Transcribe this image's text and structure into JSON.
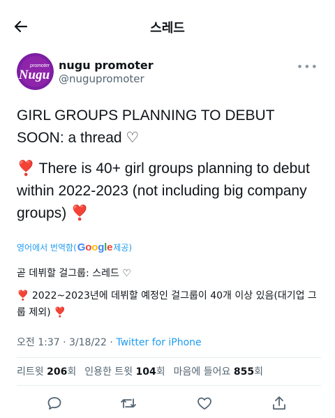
{
  "topbar": {
    "title": "스레드"
  },
  "author": {
    "name": "nugu promoter",
    "handle": "@nugupromoter",
    "avatar_text_top": "promoter",
    "avatar_text": "Nugu"
  },
  "tweet": {
    "title_line": "GIRL GROUPS PLANNING TO DEBUT SOON: a thread ♡",
    "emoji_heart": "❣️",
    "body": "There is 40+ girl groups planning to debut within 2022-2023 (not including big company groups)"
  },
  "translate": {
    "prefix": "영어에서 번역함(",
    "brand": "Google",
    "suffix": " 제공)"
  },
  "translation": {
    "line1": "곧 데뷔할 걸그룹: 스레드 ♡",
    "line2": "2022~2023년에 데뷔할 예정인 걸그룹이 40개 이상 있음(대기업 그룹 제외)"
  },
  "meta": {
    "time": "오전 1:37 · 3/18/22 · ",
    "source": "Twitter for iPhone"
  },
  "stats": {
    "retweets_label": "리트윗",
    "retweets": "206",
    "retweets_unit": "회",
    "quotes_label": "인용한 트윗",
    "quotes": "104",
    "quotes_unit": "회",
    "likes_label": "마음에 들어요",
    "likes": "855",
    "likes_unit": "회"
  },
  "actions": [
    "reply-icon",
    "retweet-icon",
    "like-icon",
    "share-icon"
  ],
  "colors": {
    "accent": "#1d9bf0",
    "muted": "#536471",
    "avatar_bg": "#7b1fa2",
    "heart": "#d0021b"
  }
}
